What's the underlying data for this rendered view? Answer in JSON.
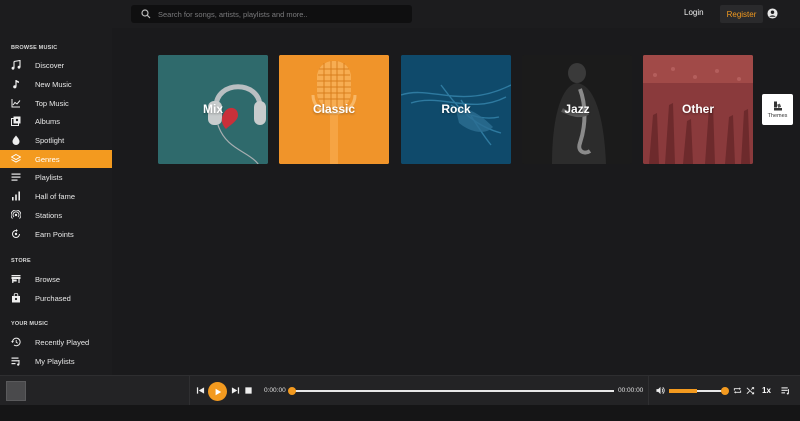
{
  "header": {
    "search_placeholder": "Search for songs, artists, playlists and more..",
    "login_label": "Login",
    "register_label": "Register"
  },
  "sidebar": {
    "browse_title": "BROWSE MUSIC",
    "browse_items": [
      {
        "label": "Discover",
        "icon": "music-note-icon"
      },
      {
        "label": "New Music",
        "icon": "single-note-icon"
      },
      {
        "label": "Top Music",
        "icon": "chart-line-icon"
      },
      {
        "label": "Albums",
        "icon": "album-icon"
      },
      {
        "label": "Spotlight",
        "icon": "spotlight-icon"
      },
      {
        "label": "Genres",
        "icon": "layers-icon",
        "active": true
      },
      {
        "label": "Playlists",
        "icon": "playlist-icon"
      },
      {
        "label": "Hall of fame",
        "icon": "bars-icon"
      },
      {
        "label": "Stations",
        "icon": "broadcast-icon"
      },
      {
        "label": "Earn Points",
        "icon": "refresh-coin-icon"
      }
    ],
    "store_title": "STORE",
    "store_items": [
      {
        "label": "Browse",
        "icon": "store-icon"
      },
      {
        "label": "Purchased",
        "icon": "bag-icon"
      }
    ],
    "your_music_title": "YOUR MUSIC",
    "your_music_items": [
      {
        "label": "Recently Played",
        "icon": "history-icon"
      },
      {
        "label": "My Playlists",
        "icon": "my-playlist-icon"
      }
    ]
  },
  "genres": [
    {
      "label": "Mix",
      "color": "#2f6a6c"
    },
    {
      "label": "Classic",
      "color": "#f0942a"
    },
    {
      "label": "Rock",
      "color": "#0e4a6c"
    },
    {
      "label": "Jazz",
      "color": "#1e1e1e"
    },
    {
      "label": "Other",
      "color": "#8c3a3c"
    }
  ],
  "themes_label": "Themes",
  "player": {
    "current_time": "0:00:00",
    "total_time": "00:00:00",
    "progress": 0,
    "volume": 0.5,
    "speed_label": "1x"
  },
  "colors": {
    "accent": "#f39a1f",
    "background": "#1c1c1e"
  }
}
